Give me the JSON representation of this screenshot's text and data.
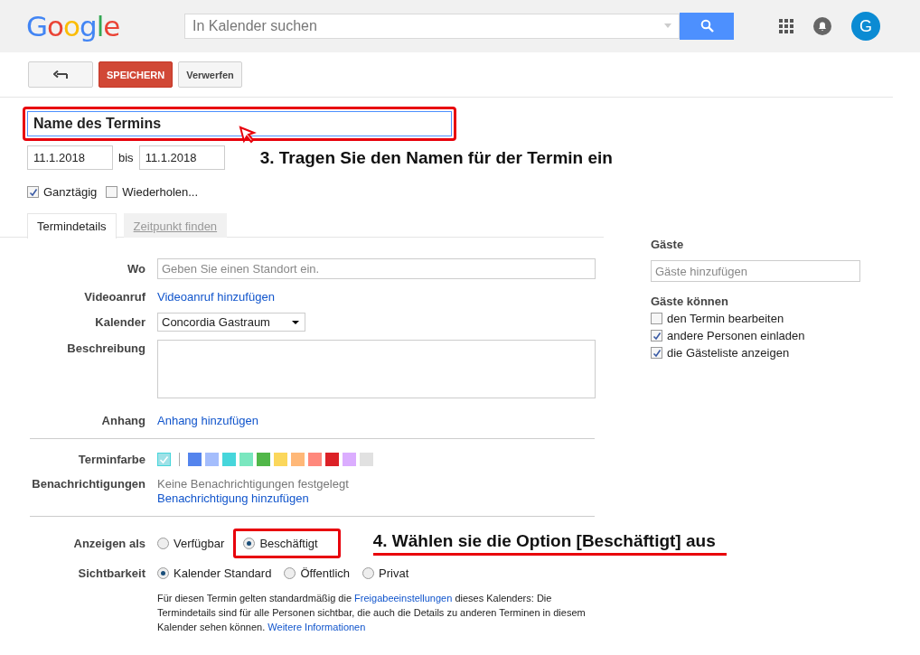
{
  "header": {
    "logo": "Google",
    "search": {
      "placeholder": "In Kalender suchen"
    },
    "avatar": "G"
  },
  "toolbar": {
    "save": "SPEICHERN",
    "discard": "Verwerfen"
  },
  "title_field": {
    "value": "Name des Termins"
  },
  "dates": {
    "start": "11.1.2018",
    "separator": "bis",
    "end": "11.1.2018"
  },
  "annotations": [
    {
      "kind": "step",
      "text": "3. Tragen Sie den Namen für der Termin ein"
    },
    {
      "kind": "step",
      "text": "4. Wählen sie die Option [Beschäftigt] aus"
    }
  ],
  "options": [
    {
      "label": "Ganztägig",
      "checked": true
    },
    {
      "label": "Wiederholen...",
      "checked": false
    }
  ],
  "tabs": [
    {
      "label": "Termindetails",
      "selected": true
    },
    {
      "label": "Zeitpunkt finden",
      "selected": false
    }
  ],
  "details": {
    "where": {
      "label": "Wo",
      "placeholder": "Geben Sie einen Standort ein."
    },
    "video": {
      "label": "Videoanruf",
      "link": "Videoanruf hinzufügen"
    },
    "calendar": {
      "label": "Kalender",
      "value": "Concordia Gastraum"
    },
    "description": {
      "label": "Beschreibung"
    },
    "attachment": {
      "label": "Anhang",
      "link": "Anhang hinzufügen"
    },
    "color": {
      "label": "Terminfarbe",
      "swatches": [
        {
          "kind": "default",
          "color": "#9fe1e7",
          "selected": true
        },
        {
          "kind": "color",
          "color": "#5484ed",
          "selected": false
        },
        {
          "kind": "color",
          "color": "#a4bdfc",
          "selected": false
        },
        {
          "kind": "color",
          "color": "#46d6db",
          "selected": false
        },
        {
          "kind": "color",
          "color": "#7ae7bf",
          "selected": false
        },
        {
          "kind": "color",
          "color": "#51b749",
          "selected": false
        },
        {
          "kind": "color",
          "color": "#fbd75b",
          "selected": false
        },
        {
          "kind": "color",
          "color": "#ffb878",
          "selected": false
        },
        {
          "kind": "color",
          "color": "#ff887c",
          "selected": false
        },
        {
          "kind": "color",
          "color": "#dc2127",
          "selected": false
        },
        {
          "kind": "color",
          "color": "#dbadff",
          "selected": false
        },
        {
          "kind": "color",
          "color": "#e1e1e1",
          "selected": false
        }
      ]
    },
    "notifications": {
      "label": "Benachrichtigungen",
      "text": "Keine Benachrichtigungen festgelegt",
      "link": "Benachrichtigung hinzufügen"
    },
    "show_as": {
      "label": "Anzeigen als",
      "choices": [
        {
          "label": "Verfügbar",
          "selected": false,
          "highlighted": false
        },
        {
          "label": "Beschäftigt",
          "selected": true,
          "highlighted": true
        }
      ]
    },
    "visibility": {
      "label": "Sichtbarkeit",
      "choices": [
        {
          "label": "Kalender Standard",
          "selected": true
        },
        {
          "label": "Öffentlich",
          "selected": false
        },
        {
          "label": "Privat",
          "selected": false
        }
      ]
    },
    "info": [
      {
        "kind": "text",
        "text": "Für diesen Termin gelten standardmäßig die "
      },
      {
        "kind": "link",
        "text": "Freigabeeinstellungen"
      },
      {
        "kind": "text",
        "text": " dieses Kalenders: Die Termindetails sind für alle Personen sichtbar, die auch die Details zu anderen Terminen in diesem Kalender sehen können.  "
      },
      {
        "kind": "link",
        "text": "Weitere Informationen"
      }
    ]
  },
  "guests": {
    "title": "Gäste",
    "placeholder": "Gäste hinzufügen",
    "permissions_title": "Gäste können",
    "permissions": [
      {
        "label": "den Termin bearbeiten",
        "checked": false
      },
      {
        "label": "andere Personen einladen",
        "checked": true
      },
      {
        "label": "die Gästeliste anzeigen",
        "checked": true
      }
    ]
  }
}
